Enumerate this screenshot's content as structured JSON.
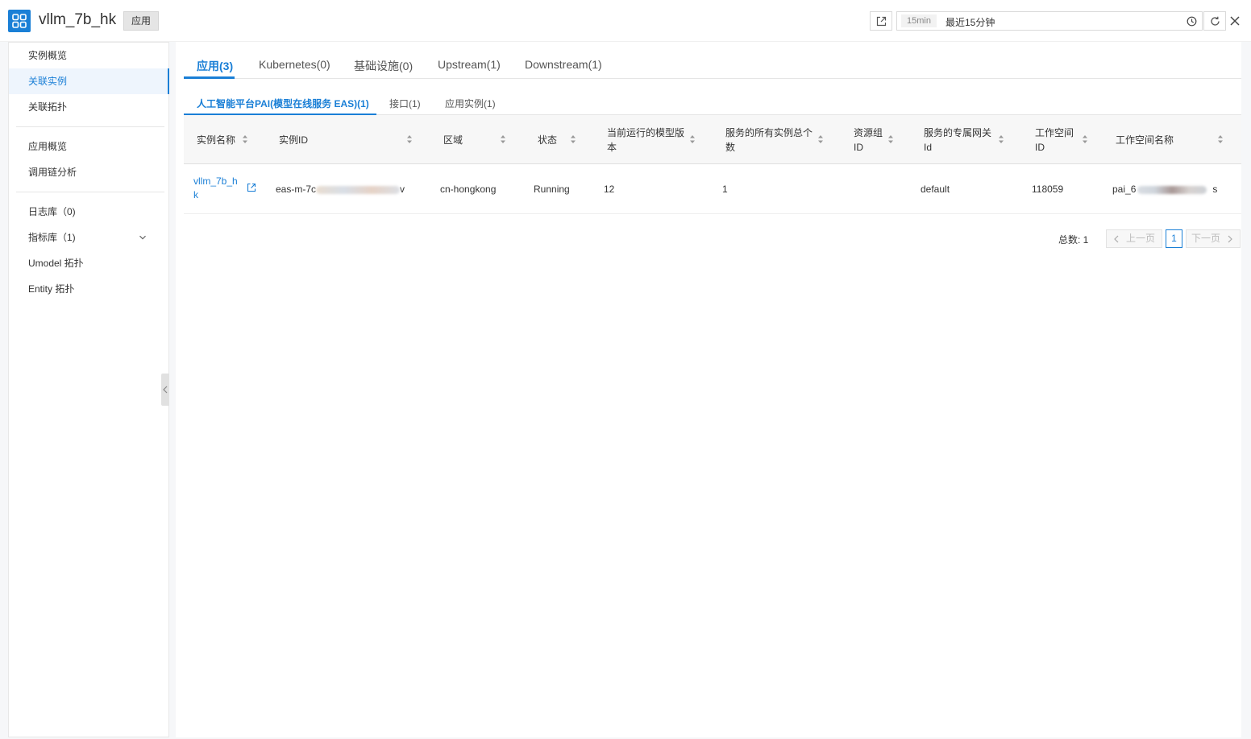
{
  "header": {
    "title": "vllm_7b_hk",
    "tag": "应用",
    "time_chip": "15min",
    "time_label": "最近15分钟"
  },
  "sidebar": {
    "items": [
      {
        "label": "实例概览",
        "active": false
      },
      {
        "label": "关联实例",
        "active": true
      },
      {
        "label": "关联拓扑",
        "active": false
      },
      {
        "label": "应用概览",
        "active": false
      },
      {
        "label": "调用链分析",
        "active": false
      },
      {
        "label": "日志库（0)",
        "active": false
      },
      {
        "label": "指标库（1)",
        "active": false
      },
      {
        "label": "Umodel 拓扑",
        "active": false
      },
      {
        "label": "Entity 拓扑",
        "active": false
      }
    ]
  },
  "tabs": [
    {
      "label": "应用(3)",
      "active": true
    },
    {
      "label": "Kubernetes(0)",
      "active": false
    },
    {
      "label": "基础设施(0)",
      "active": false
    },
    {
      "label": "Upstream(1)",
      "active": false
    },
    {
      "label": "Downstream(1)",
      "active": false
    }
  ],
  "subtabs": [
    {
      "label": "人工智能平台PAI(模型在线服务 EAS)(1)",
      "active": true
    },
    {
      "label": "接口(1)",
      "active": false
    },
    {
      "label": "应用实例(1)",
      "active": false
    }
  ],
  "table": {
    "columns": [
      {
        "line1": "实例名称",
        "line2": ""
      },
      {
        "line1": "实例ID",
        "line2": ""
      },
      {
        "line1": "区域",
        "line2": ""
      },
      {
        "line1": "状态",
        "line2": ""
      },
      {
        "line1": "当前运行的模型版",
        "line2": "本"
      },
      {
        "line1": "服务的所有实例总个",
        "line2": "数"
      },
      {
        "line1": "资源组",
        "line2": "ID"
      },
      {
        "line1": "服务的专属网关",
        "line2": "Id"
      },
      {
        "line1": "工作空间",
        "line2": "ID"
      },
      {
        "line1": "工作空间名称",
        "line2": ""
      }
    ],
    "row": {
      "name_line1": "vllm_7b_h",
      "name_line2": "k",
      "id_prefix": "eas-m-7c",
      "id_suffix": "v",
      "region": "cn-hongkong",
      "status": "Running",
      "model_version": "12",
      "instance_count": "1",
      "resource_group_id": "",
      "gateway_id": "default",
      "workspace_id": "118059",
      "workspace_name_prefix": "pai_6",
      "workspace_name_suffix": "s"
    }
  },
  "pagination": {
    "total": "总数: 1",
    "prev": "上一页",
    "current": "1",
    "next": "下一页"
  }
}
